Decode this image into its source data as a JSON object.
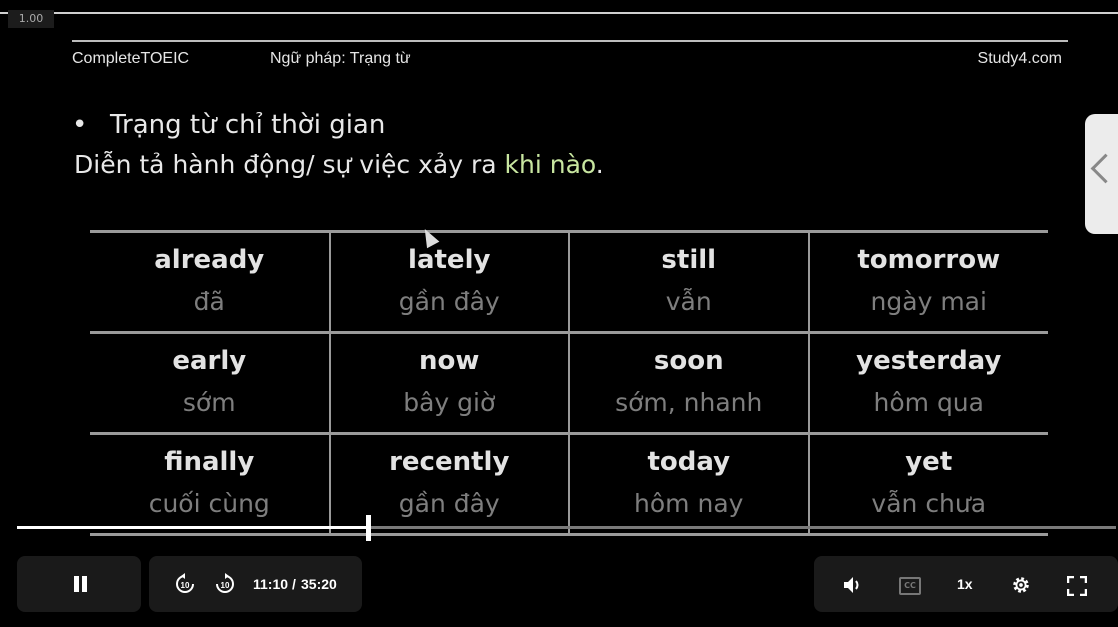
{
  "player": {
    "speed_badge": "1.00",
    "progress_fraction": 0.319,
    "time_current": "11:10",
    "time_separator": "/",
    "time_total": "35:20",
    "playback_rate": "1x",
    "cc_label": "CC",
    "skip_back_label": "10",
    "skip_forward_label": "10"
  },
  "slide": {
    "header_left": "CompleteTOEIC",
    "header_topic": "Ngữ pháp: Trạng từ",
    "header_right": "Study4.com",
    "bullet": "Trạng từ chỉ thời gian",
    "description_prefix": "Diễn tả hành động/ sự việc xảy ra ",
    "description_highlight": "khi nào",
    "description_suffix": ".",
    "table": [
      [
        {
          "en": "already",
          "vi": "đã"
        },
        {
          "en": "lately",
          "vi": "gần đây"
        },
        {
          "en": "still",
          "vi": "vẫn"
        },
        {
          "en": "tomorrow",
          "vi": "ngày mai"
        }
      ],
      [
        {
          "en": "early",
          "vi": "sớm"
        },
        {
          "en": "now",
          "vi": "bây giờ"
        },
        {
          "en": "soon",
          "vi": "sớm, nhanh"
        },
        {
          "en": "yesterday",
          "vi": "hôm qua"
        }
      ],
      [
        {
          "en": "finally",
          "vi": "cuối cùng"
        },
        {
          "en": "recently",
          "vi": "gần đây"
        },
        {
          "en": "today",
          "vi": "hôm nay"
        },
        {
          "en": "yet",
          "vi": "vẫn chưa"
        }
      ]
    ]
  },
  "colors": {
    "highlight": "#c8e6a0",
    "background": "#000000",
    "control_bg": "#1a1a1a"
  }
}
